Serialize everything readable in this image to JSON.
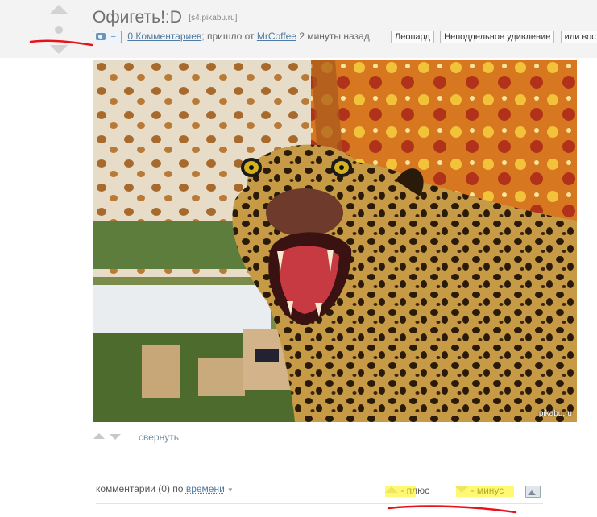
{
  "post": {
    "title": "Офигеть!:D",
    "source": "[s4.pikabu.ru]",
    "badge_dash": "–",
    "comments_link": "0 Комментариев",
    "came_from_text": "; пришло от ",
    "author": "MrCoffee",
    "time_ago": " 2 минуты назад",
    "tags": [
      "Леопард",
      "Неподдельное удивление",
      "или восторг"
    ],
    "watermark": "pikabu.ru",
    "collapse": "свернуть"
  },
  "comments_bar": {
    "prefix": "комментарии (0) по",
    "sort_by": "времени",
    "sort_caret": "▼",
    "plus_label": " - плюс",
    "minus_label": " - минус"
  },
  "colors": {
    "link": "#4f7aa3",
    "title": "#6f6f6f",
    "header_band": "#f3f3f3",
    "red_annotation": "#e8121a",
    "yellow_highlight": "#fff200"
  },
  "icons": [
    "vote-up-icon",
    "vote-down-icon",
    "camera-icon",
    "image-toggle-icon"
  ]
}
